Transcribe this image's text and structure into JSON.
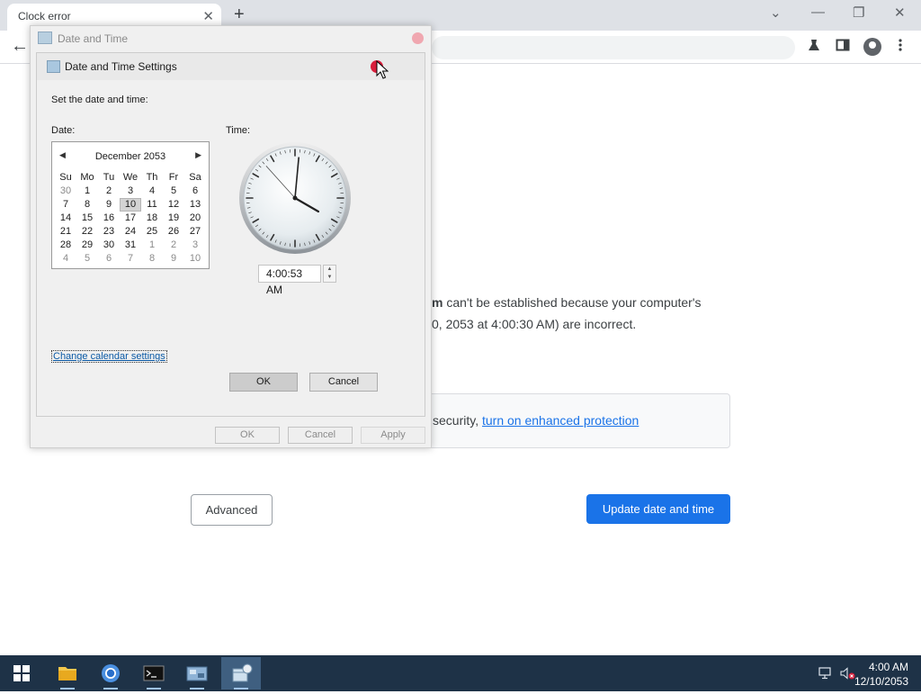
{
  "browser": {
    "tab_title": "Clock error",
    "tab_close": "✕",
    "new_tab": "+",
    "back": "←",
    "minimize": "—",
    "maximize": "❐",
    "close": "✕",
    "chevron": "⌄"
  },
  "error_page": {
    "line1_bold": "m",
    "line1_rest": " can't be established because your computer's",
    "line2": "0, 2053 at 4:00:30 AM) are incorrect.",
    "protect_prefix": "security, ",
    "protect_link": "turn on enhanced protection",
    "advanced_label": "Advanced",
    "update_label": "Update date and time"
  },
  "outer_dialog": {
    "title": "Date and Time",
    "ok": "OK",
    "cancel": "Cancel",
    "apply": "Apply",
    "ghost_btn": "..."
  },
  "inner_dialog": {
    "title": "Date and Time Settings",
    "set_label": "Set the date and time:",
    "date_label": "Date:",
    "time_label": "Time:",
    "calendar": {
      "month": "December 2053",
      "prev": "◀",
      "next": "▶",
      "weekdays": [
        "Su",
        "Mo",
        "Tu",
        "We",
        "Th",
        "Fr",
        "Sa"
      ],
      "weeks": [
        [
          "30",
          "1",
          "2",
          "3",
          "4",
          "5",
          "6"
        ],
        [
          "7",
          "8",
          "9",
          "10",
          "11",
          "12",
          "13"
        ],
        [
          "14",
          "15",
          "16",
          "17",
          "18",
          "19",
          "20"
        ],
        [
          "21",
          "22",
          "23",
          "24",
          "25",
          "26",
          "27"
        ],
        [
          "28",
          "29",
          "30",
          "31",
          "1",
          "2",
          "3"
        ],
        [
          "4",
          "5",
          "6",
          "7",
          "8",
          "9",
          "10"
        ]
      ],
      "selected": "10"
    },
    "time_value": "4:00:53 AM",
    "calendar_link": "Change calendar settings",
    "ok": "OK",
    "cancel": "Cancel"
  },
  "taskbar": {
    "time": "4:00 AM",
    "date": "12/10/2053",
    "apps": [
      "file-explorer",
      "chrome",
      "terminal",
      "control-panel",
      "date-time"
    ]
  },
  "colors": {
    "accent": "#1a73e8",
    "taskbar": "#1e3247",
    "close_red": "#d81f3c"
  }
}
